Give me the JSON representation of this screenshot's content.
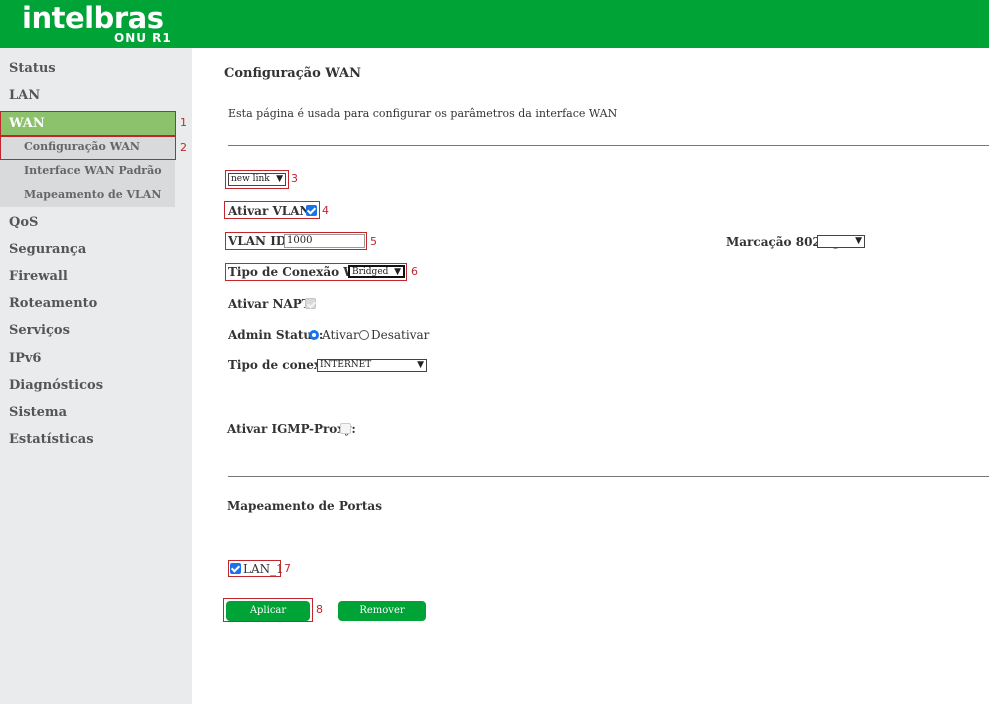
{
  "header": {
    "logo_main": "intelbras",
    "logo_sub": "ONU R1",
    "bg_color": "#00a335"
  },
  "sidebar": {
    "items": [
      {
        "label": "Status"
      },
      {
        "label": "LAN"
      },
      {
        "label": "WAN"
      },
      {
        "label": "QoS"
      },
      {
        "label": "Segurança"
      },
      {
        "label": "Firewall"
      },
      {
        "label": "Roteamento"
      },
      {
        "label": "Serviços"
      },
      {
        "label": "IPv6"
      },
      {
        "label": "Diagnósticos"
      },
      {
        "label": "Sistema"
      },
      {
        "label": "Estatísticas"
      }
    ],
    "wan_subitems": [
      {
        "label": "Configuração WAN"
      },
      {
        "label": "Interface WAN Padrão"
      },
      {
        "label": "Mapeamento de VLAN"
      }
    ]
  },
  "page": {
    "title": "Configuração WAN",
    "description": "Esta página é usada para configurar os parâmetros da interface WAN"
  },
  "form": {
    "link_select": "new link",
    "vlan_label": "Ativar VLAN:",
    "vlan_checked": true,
    "vlan_id_label": "VLAN ID:",
    "vlan_id_value": "1000",
    "marking_label": "Marcação 802.1p",
    "marking_value": "",
    "connection_type_label": "Tipo de Conexão WAN:",
    "connection_type_value": "Bridged",
    "napt_label": "Ativar NAPT:",
    "admin_status_label": "Admin Status:",
    "admin_on_label": "Ativar",
    "admin_off_label": "Desativar",
    "conn_kind_label": "Tipo de conexão:",
    "conn_kind_value": "INTERNET",
    "igmp_label": "Ativar IGMP-Proxy:",
    "port_mapping_title": "Mapeamento de Portas",
    "lan1_label": "LAN_1",
    "apply_label": "Aplicar",
    "remove_label": "Remover"
  },
  "markers": [
    "1",
    "2",
    "3",
    "4",
    "5",
    "6",
    "7",
    "8"
  ],
  "colors": {
    "accent": "#00a335",
    "active_nav": "#8cc26c",
    "annotation": "#c0272d"
  }
}
